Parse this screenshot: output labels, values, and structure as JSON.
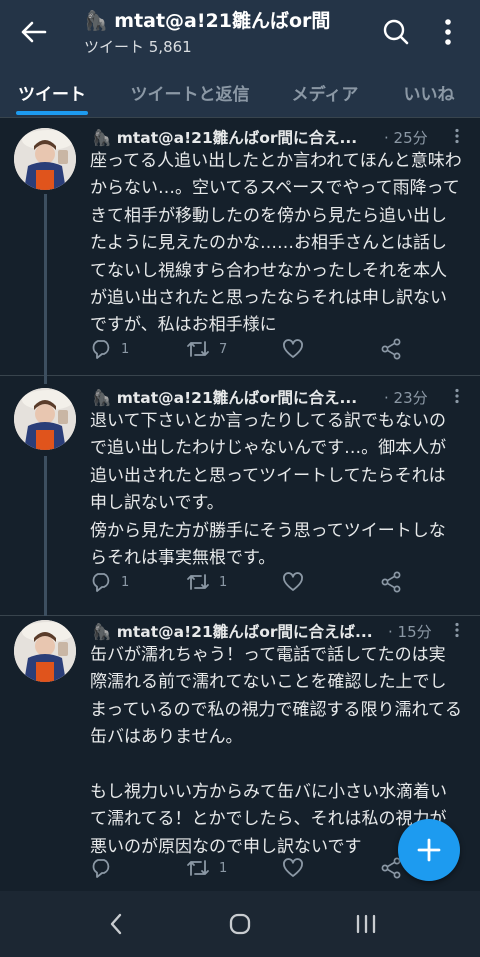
{
  "header": {
    "title": "🦍 mtat@a!21雛んばor間",
    "subtitle": "ツイート 5,861"
  },
  "tabs": [
    {
      "label": "ツイート",
      "active": true
    },
    {
      "label": "ツイートと返信",
      "active": false
    },
    {
      "label": "メディア",
      "active": false
    },
    {
      "label": "いいね",
      "active": false
    }
  ],
  "tweets": [
    {
      "name": "🦍 mtat@a!21雛んばor間に合え...",
      "time": "· 25分",
      "text": "座ってる人追い出したとか言われてほんと意味わからない…。空いてるスペースでやって雨降ってきて相手が移動したのを傍から見たら追い出したように見えたのかな……お相手さんとは話してないし視線すら合わせなかったしそれを本人が追い出されたと思ったならそれは申し訳ないですが、私はお相手様に",
      "replies": "1",
      "retweets": "7",
      "likes": ""
    },
    {
      "name": "🦍 mtat@a!21雛んばor間に合え...",
      "time": "· 23分",
      "text": "退いて下さいとか言ったりしてる訳でもないので追い出したわけじゃないんです…。御本人が追い出されたと思ってツイートしてたらそれは申し訳ないです。\n傍から見た方が勝手にそう思ってツイートしならそれは事実無根です。",
      "replies": "1",
      "retweets": "1",
      "likes": ""
    },
    {
      "name": "🦍 mtat@a!21雛んばor間に合えば...",
      "time": "· 15分",
      "text": "缶バが濡れちゃう！って電話で話してたのは実際濡れる前で濡れてないことを確認した上でしまっているので私の視力で確認する限り濡れてる缶バはありません。\n\nもし視力いい方からみて缶バに小さい水滴着いて濡れてる！とかでしたら、それは私の視力が悪いのが原因なので申し訳ないです",
      "replies": "",
      "retweets": "1",
      "likes": ""
    }
  ],
  "icons": {
    "back": "arrow-left",
    "search": "magnifier",
    "more": "vertical-ellipsis",
    "reply": "speech-bubble",
    "retweet": "retweet-arrows",
    "like": "heart",
    "share": "share-nodes",
    "compose": "plus",
    "nav_back": "chevron-left",
    "nav_home": "circle",
    "nav_recent": "three-bars"
  },
  "colors": {
    "background": "#15202b",
    "header": "#243447",
    "accent": "#1d9bf0",
    "muted": "#8b98a5"
  }
}
